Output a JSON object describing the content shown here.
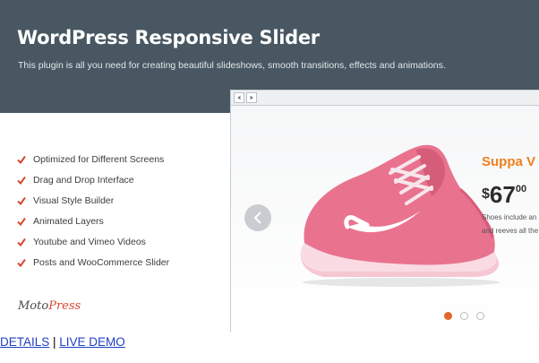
{
  "header": {
    "title": "WordPress Responsive Slider",
    "subtitle": "This plugin is all you need for creating beautiful slideshows, smooth transitions, effects and animations."
  },
  "features": [
    "Optimized for Different Screens",
    "Drag and Drop Interface",
    "Visual Style Builder",
    "Animated Layers",
    "Youtube and Vimeo Videos",
    "Posts and WooCommerce Slider"
  ],
  "logo": {
    "part1": "Moto",
    "part2": "Press"
  },
  "slide": {
    "product_name": "Suppa V",
    "price_currency": "$",
    "price_main": "67",
    "price_cents": "00",
    "description_lines": [
      "Shoes include an",
      "and reeves all the"
    ],
    "dots_total": 3,
    "active_dot": 1
  },
  "links": {
    "details": "DETAILS",
    "separator": " | ",
    "live_demo": "LIVE DEMO"
  },
  "colors": {
    "header_bg": "#485761",
    "accent_orange": "#f07f1d",
    "check_red": "#d9462f",
    "shoe_pink": "#e9738f",
    "link_blue": "#1f3fc4"
  },
  "icons": {
    "feature_bullet": "checkmark-icon",
    "slider_prev": "chevron-left-icon",
    "browser_back": "triangle-left-icon",
    "browser_forward": "triangle-right-icon"
  }
}
